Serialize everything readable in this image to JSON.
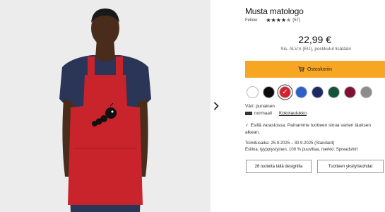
{
  "product": {
    "title": "Musta matologo",
    "brand": "Fellow",
    "rating": 4.5,
    "review_count": "(57)",
    "price": "22,99 €",
    "tax_note": "Sis. ALV:n (EU), postikulut lisätään"
  },
  "cart_button": {
    "label": "Ostoskoriin",
    "color": "#f7a623"
  },
  "colors": {
    "selected_label": "Väri: punainen",
    "swatches": [
      {
        "name": "valkoinen",
        "hex": "#ffffff"
      },
      {
        "name": "musta",
        "hex": "#0b0b0b"
      },
      {
        "name": "punainen",
        "hex": "#d4202f"
      },
      {
        "name": "sininen",
        "hex": "#2f5fc9"
      },
      {
        "name": "tummansininen",
        "hex": "#1d2a66"
      },
      {
        "name": "vihreä",
        "hex": "#13533a"
      },
      {
        "name": "viininpunainen",
        "hex": "#7d1234"
      },
      {
        "name": "harmaa",
        "hex": "#8c8c8c"
      }
    ],
    "selected_index": 2
  },
  "size": {
    "value": "normaali",
    "guide_label": "Kokotaulukko"
  },
  "stock": {
    "text": "Esillä varastossa. Painamme tuotteen sinua varten täuksen alkean."
  },
  "delivery": {
    "time": "Toimitusaika: 25.9.2025 – 30.9.2025 (Standard)",
    "material": "Esilina, tyyppiystyinen, 100 % puuvillaa, merkki: Spreadshirt"
  },
  "buttons": {
    "designs": "26 tuotetta tällä designilla",
    "similar": "Tuotteen yksityiskohdat"
  },
  "gallery": {
    "next_icon": "chevron-right-icon"
  }
}
